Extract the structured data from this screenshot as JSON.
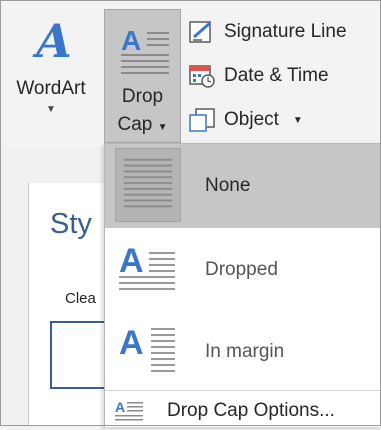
{
  "ribbon": {
    "wordart": {
      "label": "WordArt"
    },
    "dropcap": {
      "label_line1": "Drop",
      "label_line2": "Cap"
    },
    "signature_line": {
      "label": "Signature Line"
    },
    "date_time": {
      "label": "Date & Time"
    },
    "object": {
      "label": "Object"
    }
  },
  "document": {
    "styles_heading": "Sty",
    "clear_text": "Clea"
  },
  "dropdown": {
    "items": [
      {
        "label": "None",
        "selected": true
      },
      {
        "label": "Dropped",
        "selected": false
      },
      {
        "label": "In margin",
        "selected": false
      }
    ],
    "options_label": "Drop Cap Options..."
  },
  "colors": {
    "accent_blue": "#3a77c8",
    "selected_bg": "#c6c6c6",
    "ribbon_bg": "#f3f3f3"
  },
  "icons": {
    "wordart": "wordart-a-icon",
    "dropcap": "dropcap-icon",
    "signature": "signature-line-icon",
    "datetime": "calendar-clock-icon",
    "object": "object-icon"
  }
}
